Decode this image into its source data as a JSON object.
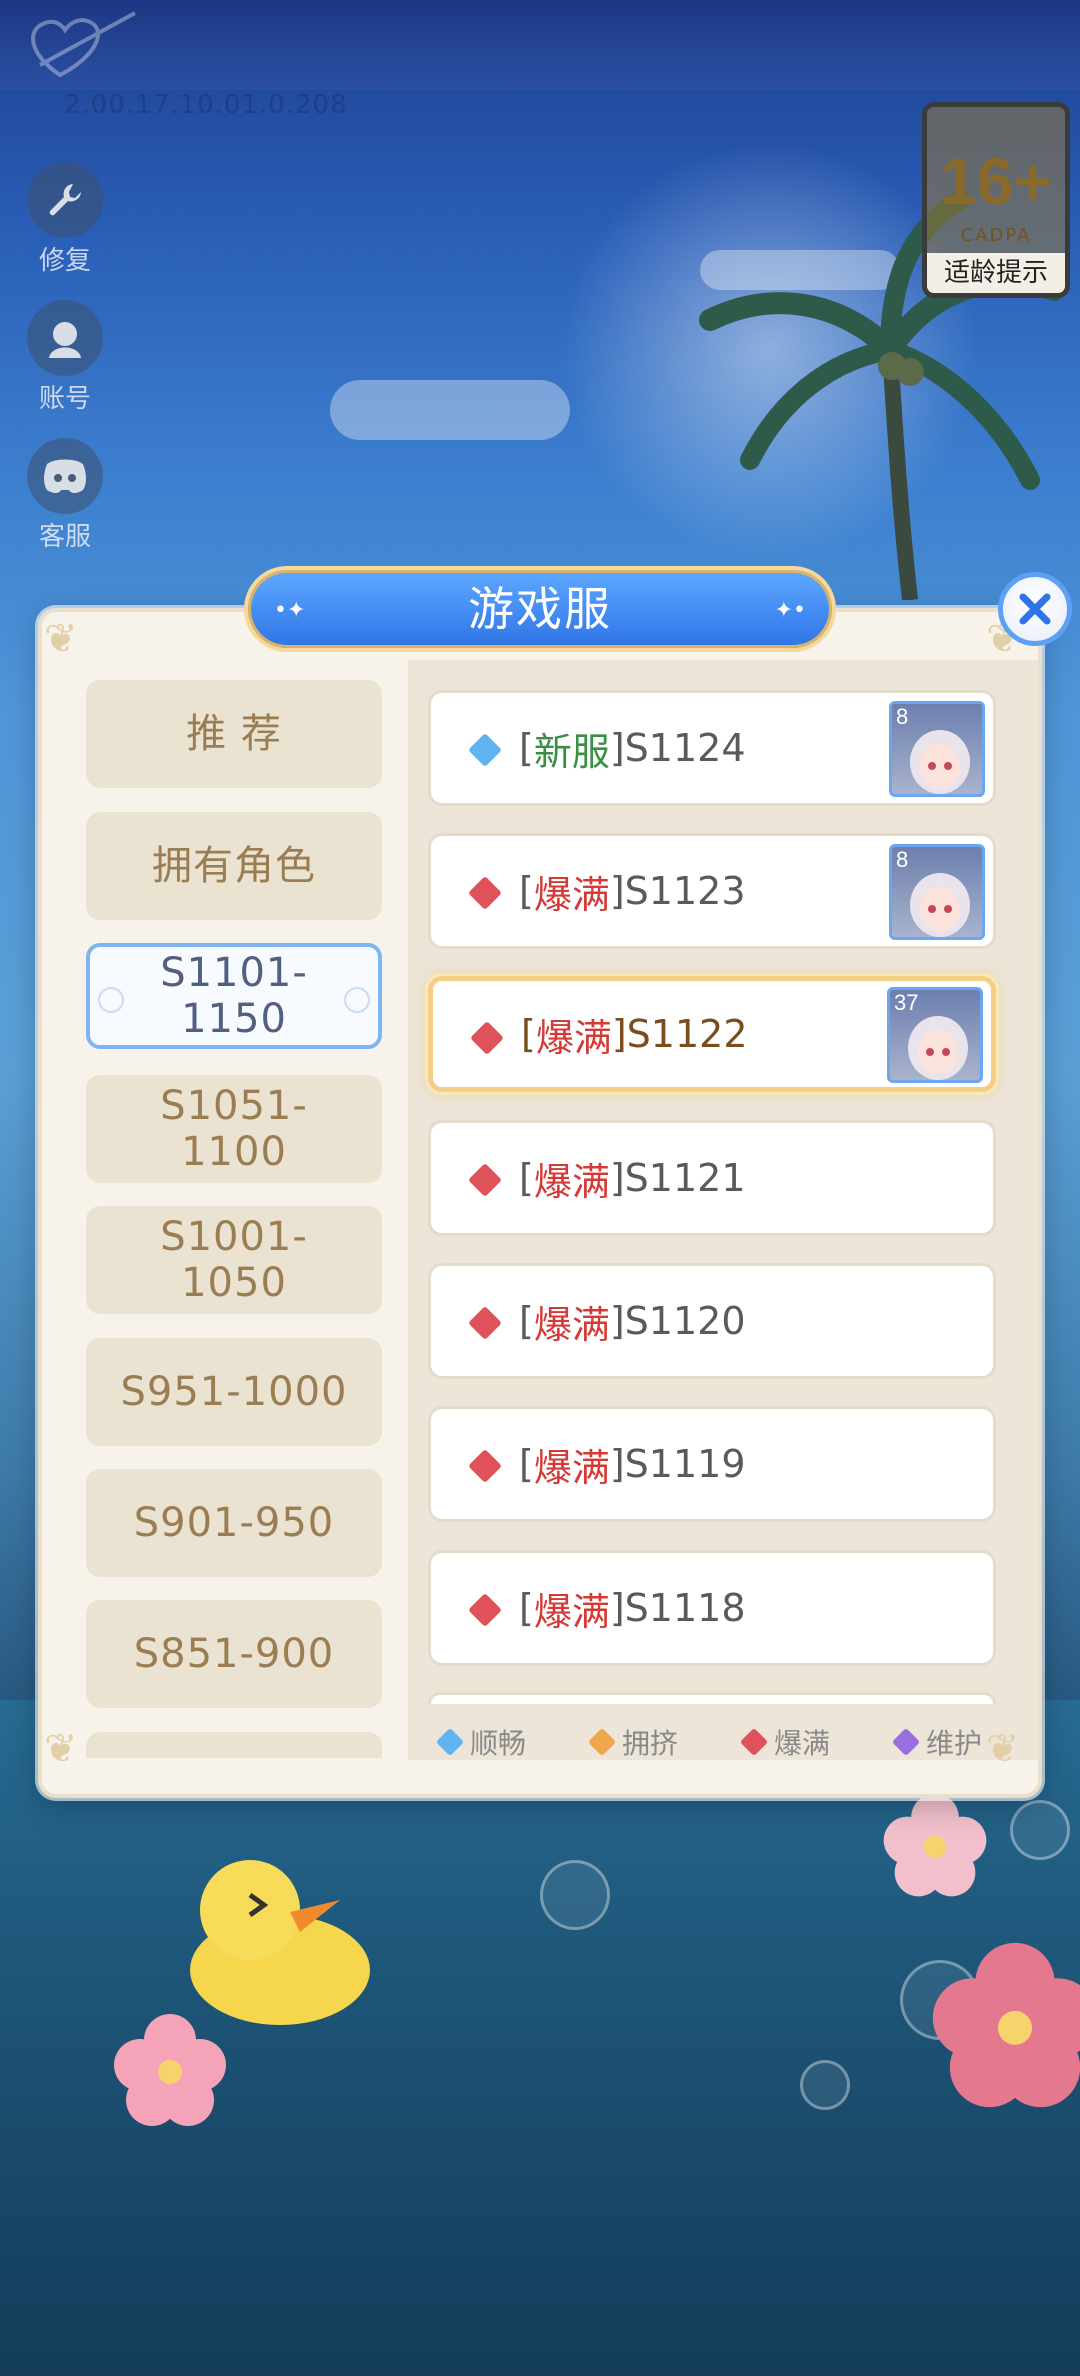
{
  "app": {
    "version_text": "2.00.17.10.01.0.208"
  },
  "side_buttons": [
    {
      "label": "修复",
      "icon": "wrench-icon"
    },
    {
      "label": "账号",
      "icon": "avatar-icon"
    },
    {
      "label": "客服",
      "icon": "discord-icon"
    }
  ],
  "age_badge": {
    "rating": "16+",
    "org": "CADPA",
    "tip": "适龄提示"
  },
  "dialog": {
    "title": "游戏服",
    "close_icon": "close-icon"
  },
  "categories": [
    {
      "label": "推 荐",
      "active": false
    },
    {
      "label": "拥有角色",
      "active": false
    },
    {
      "label": "S1101-\n1150",
      "active": true
    },
    {
      "label": "S1051-\n1100",
      "active": false
    },
    {
      "label": "S1001-\n1050",
      "active": false
    },
    {
      "label": "S951-1000",
      "active": false
    },
    {
      "label": "S901-950",
      "active": false
    },
    {
      "label": "S851-900",
      "active": false
    }
  ],
  "servers": [
    {
      "bracket_open": "[",
      "status_tag": "新服",
      "bracket_close": "]",
      "name": "S1124",
      "status": "smooth",
      "avatar_level": "8",
      "selected": false
    },
    {
      "bracket_open": "[",
      "status_tag": "爆满",
      "bracket_close": "]",
      "name": "S1123",
      "status": "full",
      "avatar_level": "8",
      "selected": false
    },
    {
      "bracket_open": "[",
      "status_tag": "爆满",
      "bracket_close": "]",
      "name": "S1122",
      "status": "full",
      "avatar_level": "37",
      "selected": true
    },
    {
      "bracket_open": "[",
      "status_tag": "爆满",
      "bracket_close": "]",
      "name": "S1121",
      "status": "full",
      "avatar_level": null,
      "selected": false
    },
    {
      "bracket_open": "[",
      "status_tag": "爆满",
      "bracket_close": "]",
      "name": "S1120",
      "status": "full",
      "avatar_level": null,
      "selected": false
    },
    {
      "bracket_open": "[",
      "status_tag": "爆满",
      "bracket_close": "]",
      "name": "S1119",
      "status": "full",
      "avatar_level": null,
      "selected": false
    },
    {
      "bracket_open": "[",
      "status_tag": "爆满",
      "bracket_close": "]",
      "name": "S1118",
      "status": "full",
      "avatar_level": null,
      "selected": false
    }
  ],
  "legend": [
    {
      "label": "顺畅",
      "color": "#5fb3ee"
    },
    {
      "label": "拥挤",
      "color": "#f0a64a"
    },
    {
      "label": "爆满",
      "color": "#e0525a"
    },
    {
      "label": "维护",
      "color": "#9b6ee0"
    }
  ],
  "colors": {
    "smooth": "#5fb3ee",
    "crowded": "#f0a64a",
    "full": "#e0525a",
    "maintenance": "#9b6ee0",
    "accent_blue": "#2f74e6"
  }
}
